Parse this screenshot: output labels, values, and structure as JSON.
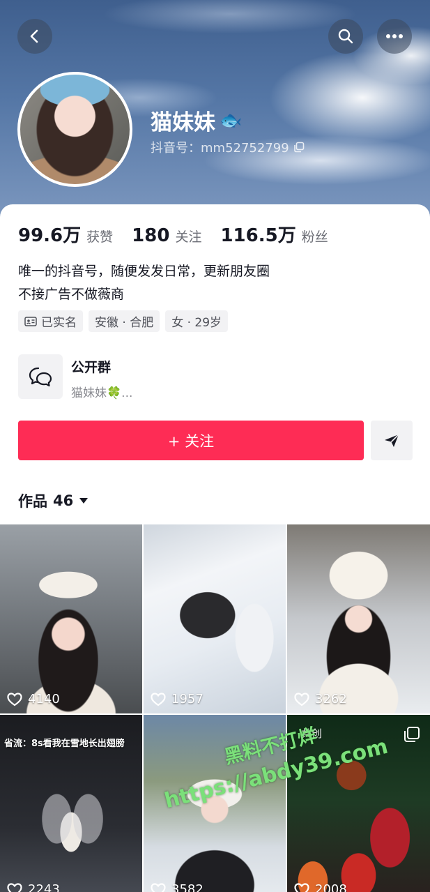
{
  "header": {
    "nickname": "猫妹妹",
    "nickname_emoji": "🐟",
    "douyin_id": "抖音号：mm52752799"
  },
  "stats": [
    {
      "value": "99.6万",
      "label": "获赞"
    },
    {
      "value": "180",
      "label": "关注"
    },
    {
      "value": "116.5万",
      "label": "粉丝"
    }
  ],
  "bio": {
    "line1": "唯一的抖音号，随便发发日常，更新朋友圈",
    "line2": "不接广告不做薇商"
  },
  "tags": {
    "verified": "已实名",
    "location": "安徽 · 合肥",
    "gender_age": "女 · 29岁"
  },
  "group": {
    "title": "公开群",
    "subtitle": "猫妹妹🍀..."
  },
  "actions": {
    "follow_label": "+ 关注"
  },
  "works": {
    "label": "作品",
    "count": "46"
  },
  "videos": [
    {
      "likes": "4140"
    },
    {
      "likes": "1957"
    },
    {
      "likes": "3262"
    },
    {
      "likes": "2243",
      "caption": "省流：8s看我在雪地长出翅膀"
    },
    {
      "likes": "3582"
    },
    {
      "likes": "2008",
      "label": "共创"
    }
  ],
  "watermark": {
    "line1": "黑料不打烊",
    "line2": "https://abdy39.com"
  },
  "colors": {
    "accent": "#fe2c55",
    "text_primary": "#161823",
    "text_secondary": "#6b6d75",
    "chip_bg": "#f2f2f4"
  }
}
